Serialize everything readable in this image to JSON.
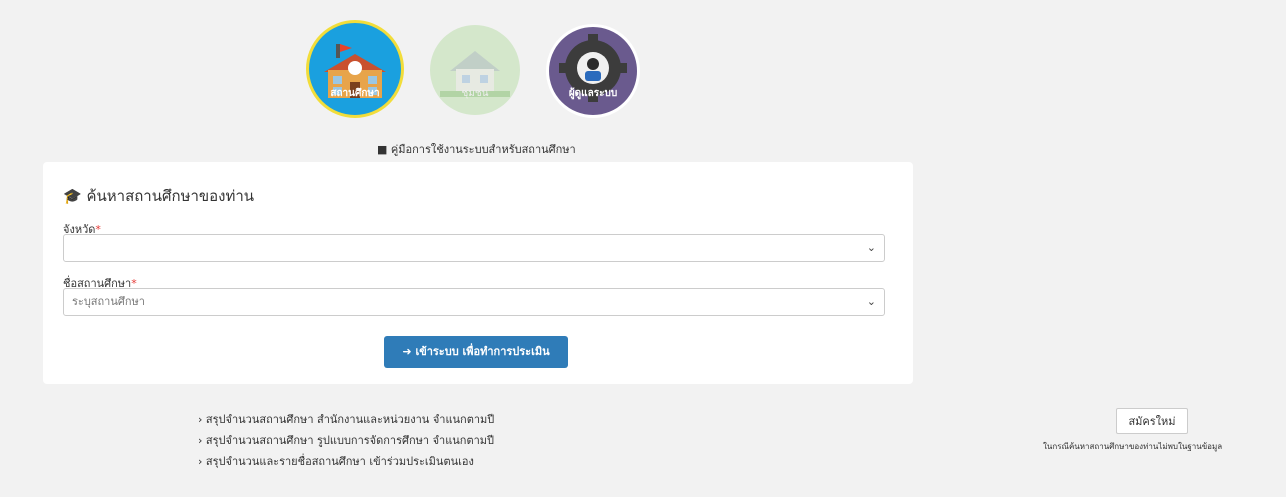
{
  "roles": [
    {
      "label": "สถานศึกษา"
    },
    {
      "label": "ชุมชน"
    },
    {
      "label": "ผู้ดูแลระบบ"
    }
  ],
  "manual_link": "คู่มือการใช้งานระบบสำหรับสถานศึกษา",
  "search": {
    "title": "ค้นหาสถานศึกษาของท่าน",
    "province_label": "จังหวัด",
    "province_value": "",
    "school_label": "ชื่อสถานศึกษา",
    "school_placeholder": "ระบุสถานศึกษา",
    "login_button": "เข้าระบบ เพื่อทำการประเมิน"
  },
  "summary_links": [
    "สรุปจำนวนสถานศึกษา สำนักงานและหน่วยงาน จำแนกตามปี",
    "สรุปจำนวนสถานศึกษา รูปแบบการจัดการศึกษา จำแนกตามปี",
    "สรุปจำนวนและรายชื่อสถานศึกษา เข้าร่วมประเมินตนเอง"
  ],
  "signup": {
    "button": "สมัครใหม่",
    "note": "ในกรณีค้นหาสถานศึกษาของท่านไม่พบในฐานข้อมูล"
  },
  "icons": [
    "school-icon",
    "house-icon",
    "gear-user-icon",
    "book-icon",
    "graduation-cap-icon",
    "chevron-down-icon",
    "sign-in-icon",
    "chevron-right-icon"
  ]
}
